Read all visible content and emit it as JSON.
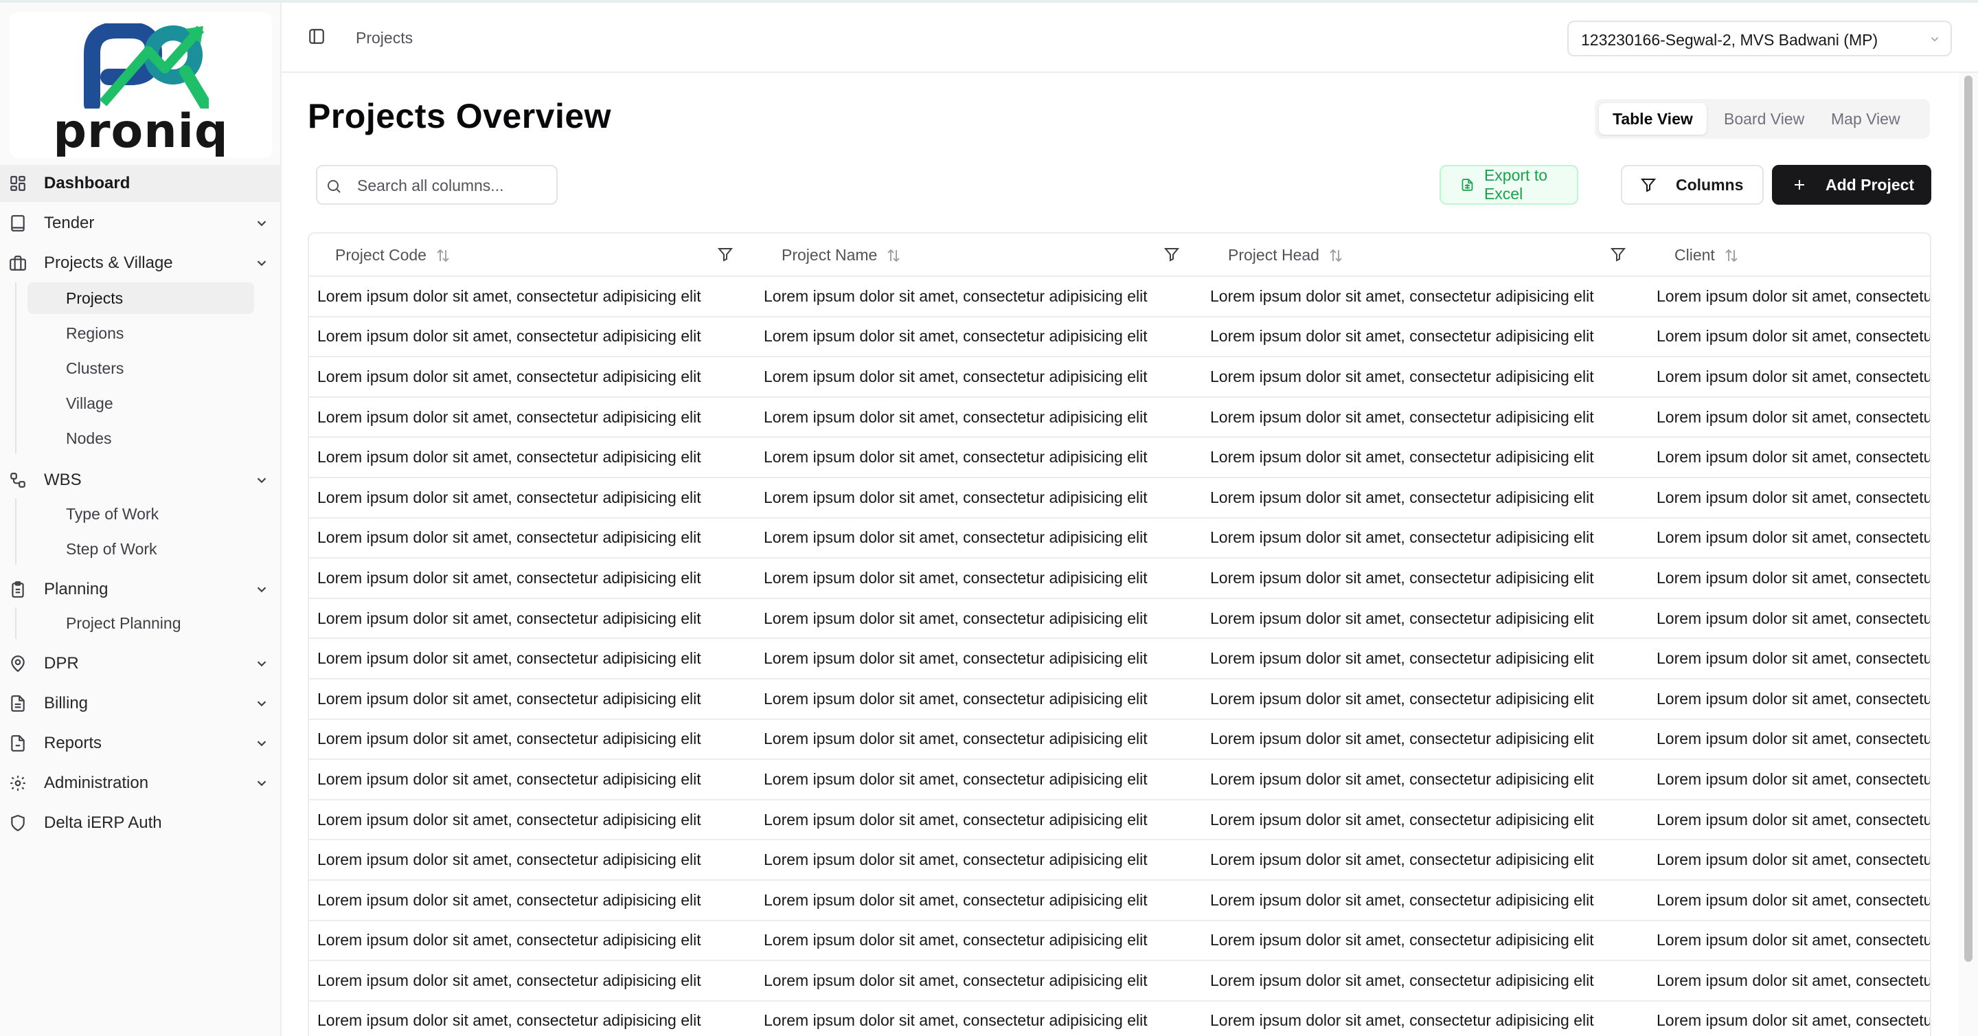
{
  "app": {
    "logo_text": "proniq"
  },
  "sidebar": {
    "items": [
      {
        "label": "Dashboard",
        "icon": "grid-icon",
        "active": true
      },
      {
        "label": "Tender",
        "icon": "tablet-icon",
        "expandable": true
      },
      {
        "label": "Projects & Village",
        "icon": "buildings-icon",
        "expandable": true,
        "children": [
          "Projects",
          "Regions",
          "Clusters",
          "Village",
          "Nodes"
        ],
        "active_child": "Projects"
      },
      {
        "label": "WBS",
        "icon": "workflow-icon",
        "expandable": true,
        "children": [
          "Type of Work",
          "Step of Work"
        ]
      },
      {
        "label": "Planning",
        "icon": "clipboard-icon",
        "expandable": true,
        "children": [
          "Project Planning"
        ]
      },
      {
        "label": "DPR",
        "icon": "map-pin-icon",
        "expandable": true
      },
      {
        "label": "Billing",
        "icon": "receipt-icon",
        "expandable": true
      },
      {
        "label": "Reports",
        "icon": "report-icon",
        "expandable": true
      },
      {
        "label": "Administration",
        "icon": "gear-icon",
        "expandable": true
      },
      {
        "label": "Delta iERP Auth",
        "icon": "shield-icon"
      }
    ]
  },
  "header": {
    "breadcrumb": "Projects",
    "project_selector": "123230166-Segwal-2, MVS Badwani (MP)"
  },
  "main": {
    "title": "Projects Overview",
    "views": [
      "Table View",
      "Board View",
      "Map View"
    ],
    "active_view": "Table View",
    "search_placeholder": "Search all columns...",
    "export_label": "Export to Excel",
    "columns_label": "Columns",
    "add_label": "Add Project"
  },
  "table": {
    "columns": [
      "Project Code",
      "Project Name",
      "Project Head",
      "Client"
    ],
    "cell_text": "Lorem ipsum dolor sit amet, consectetur adipisicing elit",
    "row_count": 19
  },
  "colors": {
    "export_green": "#16a34a",
    "primary_dark": "#18181b",
    "logo_blue": "#1f4e96",
    "logo_teal": "#1b8f9a",
    "logo_green": "#1fbf6a"
  }
}
